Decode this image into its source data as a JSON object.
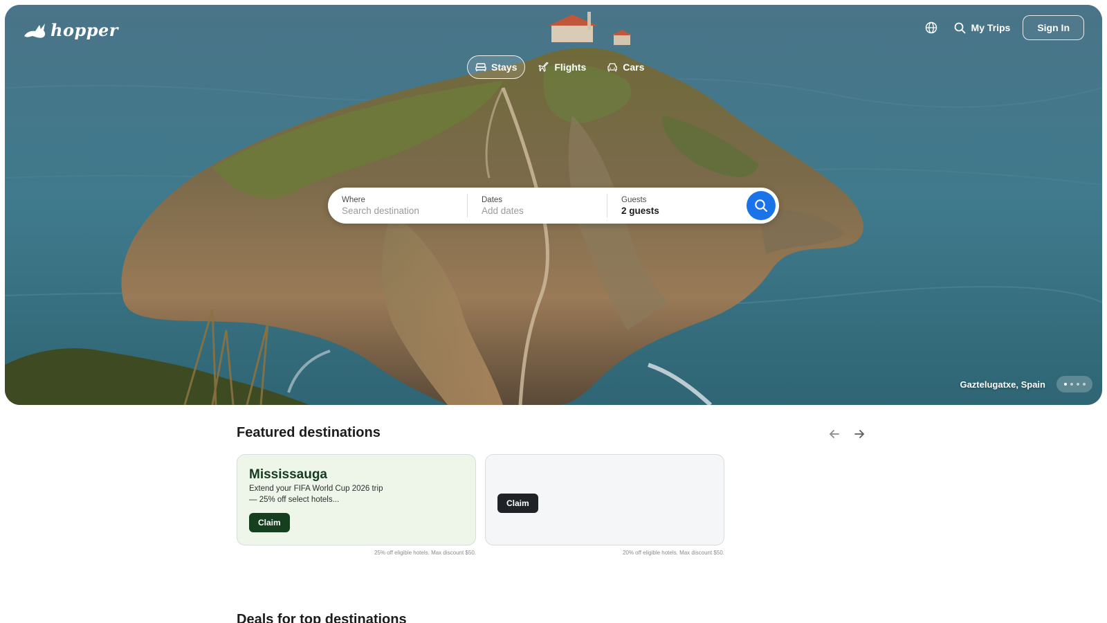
{
  "brand": {
    "name": "hopper"
  },
  "header": {
    "language_icon": "globe-icon",
    "my_trips_label": "My Trips",
    "sign_in_label": "Sign In"
  },
  "modes": [
    {
      "label": "Stays",
      "icon": "bed-icon",
      "active": true
    },
    {
      "label": "Flights",
      "icon": "airplane-icon",
      "active": false
    },
    {
      "label": "Cars",
      "icon": "car-icon",
      "active": false
    }
  ],
  "search": {
    "where_label": "Where",
    "where_placeholder": "Search destination",
    "dates_label": "Dates",
    "dates_placeholder": "Add dates",
    "guests_label": "Guests",
    "guests_value": "2 guests",
    "button_icon": "search-icon",
    "button_color": "#1a73e8"
  },
  "hero": {
    "caption": "Gaztelugatxe, Spain",
    "slide_count": 4,
    "active_slide": 1
  },
  "featured": {
    "title": "Featured destinations",
    "cards": [
      {
        "title": "Mississauga",
        "description": "Extend your FIFA World Cup 2026 trip — 25% off select hotels...",
        "button": "Claim",
        "fine_print": "25% off eligible hotels. Max discount $50.",
        "background": "#eef6ea",
        "button_color": "#153f1f"
      },
      {
        "title": "",
        "description": "",
        "button": "Claim",
        "fine_print": "20% off eligible hotels. Max discount $50.",
        "background": "#f5f6f7",
        "button_color": "#1f2226"
      }
    ]
  },
  "deals": {
    "title": "Deals for top destinations"
  }
}
